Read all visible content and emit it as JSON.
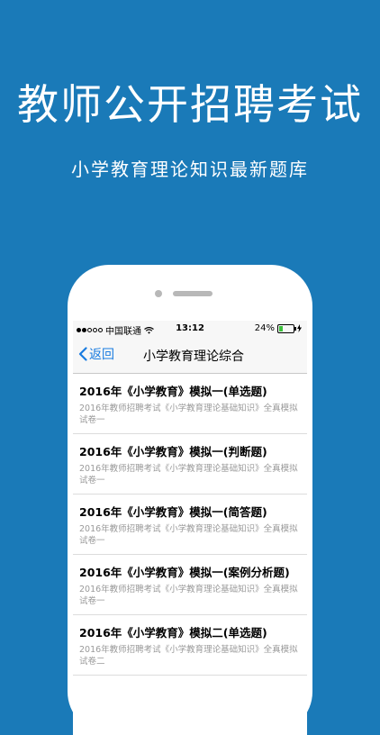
{
  "promo": {
    "headline": "教师公开招聘考试",
    "subheadline": "小学教育理论知识最新题库"
  },
  "statusbar": {
    "carrier": "中国联通",
    "time": "13:12",
    "battery": "24%",
    "battery_level": 0.24,
    "battery_color": "#3cc13c"
  },
  "navbar": {
    "back_label": "返回",
    "title": "小学教育理论综合"
  },
  "list": [
    {
      "title": "2016年《小学教育》模拟一(单选题)",
      "subtitle": "2016年教师招聘考试《小学教育理论基础知识》全真模拟试卷一"
    },
    {
      "title": "2016年《小学教育》模拟一(判断题)",
      "subtitle": "2016年教师招聘考试《小学教育理论基础知识》全真模拟试卷一"
    },
    {
      "title": "2016年《小学教育》模拟一(简答题)",
      "subtitle": "2016年教师招聘考试《小学教育理论基础知识》全真模拟试卷一"
    },
    {
      "title": "2016年《小学教育》模拟一(案例分析题)",
      "subtitle": "2016年教师招聘考试《小学教育理论基础知识》全真模拟试卷一"
    },
    {
      "title": "2016年《小学教育》模拟二(单选题)",
      "subtitle": "2016年教师招聘考试《小学教育理论基础知识》全真模拟试卷二"
    }
  ],
  "colors": {
    "background": "#1a7ab8",
    "accent": "#1a7ce0"
  }
}
